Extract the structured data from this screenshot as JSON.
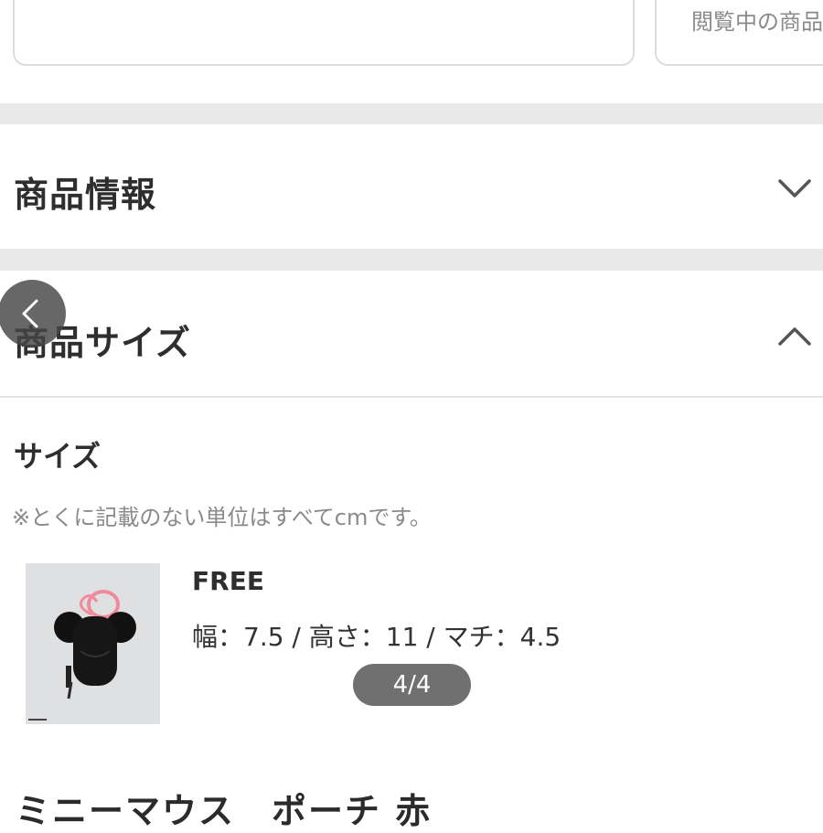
{
  "top_cards": {
    "right_text": "閲覧中の商品"
  },
  "sections": [
    {
      "title": "商品情報",
      "state": "collapsed",
      "icon": "chevron-down-icon"
    },
    {
      "title": "商品サイズ",
      "state": "expanded",
      "icon": "chevron-up-icon"
    }
  ],
  "size_block": {
    "heading": "サイズ",
    "note": "※とくに記載のない単位はすべてcmです。",
    "entries": [
      {
        "name": "FREE",
        "dimensions": "幅：7.5 / 高さ：11 / マチ：4.5"
      }
    ]
  },
  "gallery": {
    "page_indicator": "4/4"
  },
  "product": {
    "name": "ミニーマウス　ポーチ 赤"
  },
  "icons": {
    "back": "chevron-left-icon",
    "thumbnail": "minnie-pouch-image"
  },
  "colors": {
    "gap": "#e9e9e9",
    "badge": "#707070",
    "back_button": "#464646"
  }
}
